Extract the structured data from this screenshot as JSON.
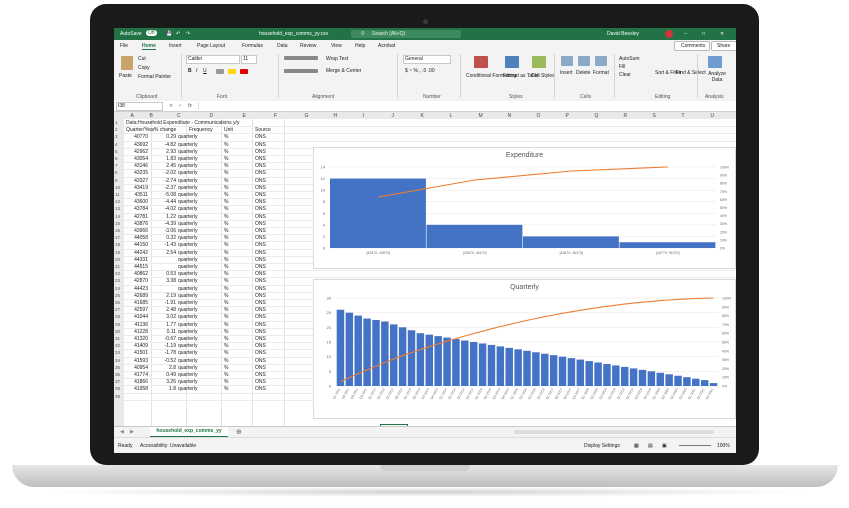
{
  "window": {
    "autosave_label": "AutoSave",
    "autosave_state": "Off",
    "file_name": "household_exp_comms_yy.csv",
    "search_placeholder": "Search (Alt+Q)",
    "user_name": "David Beesley"
  },
  "menu": {
    "tabs": [
      "File",
      "Home",
      "Insert",
      "Page Layout",
      "Formulas",
      "Data",
      "Review",
      "View",
      "Help",
      "Acrobat"
    ],
    "active_tab": "Home",
    "comments_label": "Comments",
    "share_label": "Share"
  },
  "ribbon": {
    "clipboard": {
      "paste": "Paste",
      "cut": "Cut",
      "copy": "Copy",
      "format_painter": "Format Painter",
      "label": "Clipboard"
    },
    "font": {
      "name": "Calibri",
      "size": "11",
      "label": "Font"
    },
    "alignment": {
      "wrap_text": "Wrap Text",
      "merge_center": "Merge & Center",
      "label": "Alignment"
    },
    "number": {
      "format": "General",
      "label": "Number"
    },
    "styles": {
      "conditional": "Conditional Formatting",
      "format_table": "Format as Table",
      "cell_styles": "Cell Styles",
      "label": "Styles"
    },
    "cells": {
      "insert": "Insert",
      "delete": "Delete",
      "format": "Format",
      "label": "Cells"
    },
    "editing": {
      "autosum": "AutoSum",
      "fill": "Fill",
      "clear": "Clear",
      "sort_filter": "Sort & Filter",
      "find_select": "Find & Select",
      "label": "Editing"
    },
    "analysis": {
      "analyze": "Analyze Data",
      "label": "Analysis"
    }
  },
  "formula_bar": {
    "name_box": "I38",
    "fx": "fx"
  },
  "columns": [
    "A",
    "B",
    "C",
    "D",
    "E",
    "F",
    "G",
    "H",
    "I",
    "J",
    "K",
    "L",
    "M",
    "N",
    "O",
    "P",
    "Q",
    "R",
    "S",
    "T",
    "U"
  ],
  "sheet": {
    "title_row": "Data:Household Expenditure - Communications y/y",
    "headers": [
      "Quarter/Year",
      "% change",
      "Frequency",
      "Unit",
      "Source"
    ],
    "rows": [
      [
        "40770",
        "0.29",
        "quarterly",
        "%",
        "ONS"
      ],
      [
        "43692",
        "-4.82",
        "quarterly",
        "%",
        "ONS"
      ],
      [
        "42962",
        "2.93",
        "quarterly",
        "%",
        "ONS"
      ],
      [
        "43054",
        "1.83",
        "quarterly",
        "%",
        "ONS"
      ],
      [
        "43146",
        "2.45",
        "quarterly",
        "%",
        "ONS"
      ],
      [
        "43235",
        "-2.02",
        "quarterly",
        "%",
        "ONS"
      ],
      [
        "43327",
        "-2.74",
        "quarterly",
        "%",
        "ONS"
      ],
      [
        "43419",
        "-2.37",
        "quarterly",
        "%",
        "ONS"
      ],
      [
        "43511",
        "-5.08",
        "quarterly",
        "%",
        "ONS"
      ],
      [
        "43600",
        "-4.44",
        "quarterly",
        "%",
        "ONS"
      ],
      [
        "43784",
        "-4.02",
        "quarterly",
        "%",
        "ONS"
      ],
      [
        "42781",
        "1.22",
        "quarterly",
        "%",
        "ONS"
      ],
      [
        "43876",
        "-4.39",
        "quarterly",
        "%",
        "ONS"
      ],
      [
        "43966",
        "-3.06",
        "quarterly",
        "%",
        "ONS"
      ],
      [
        "44058",
        "0.32",
        "quarterly",
        "%",
        "ONS"
      ],
      [
        "44150",
        "-1.43",
        "quarterly",
        "%",
        "ONS"
      ],
      [
        "44242",
        "2.54",
        "quarterly",
        "%",
        "ONS"
      ],
      [
        "44331",
        "",
        "quarterly",
        "%",
        "ONS"
      ],
      [
        "44515",
        "",
        "quarterly",
        "%",
        "ONS"
      ],
      [
        "40862",
        "0.53",
        "quarterly",
        "%",
        "ONS"
      ],
      [
        "42870",
        "3.38",
        "quarterly",
        "%",
        "ONS"
      ],
      [
        "44423",
        "",
        "quarterly",
        "%",
        "ONS"
      ],
      [
        "42689",
        "2.19",
        "quarterly",
        "%",
        "ONS"
      ],
      [
        "41685",
        "-1.91",
        "quarterly",
        "%",
        "ONS"
      ],
      [
        "42597",
        "2.48",
        "quarterly",
        "%",
        "ONS"
      ],
      [
        "41044",
        "3.02",
        "quarterly",
        "%",
        "ONS"
      ],
      [
        "41136",
        "1.77",
        "quarterly",
        "%",
        "ONS"
      ],
      [
        "41228",
        "0.11",
        "quarterly",
        "%",
        "ONS"
      ],
      [
        "41320",
        "-0.67",
        "quarterly",
        "%",
        "ONS"
      ],
      [
        "41409",
        "-1.19",
        "quarterly",
        "%",
        "ONS"
      ],
      [
        "41501",
        "-1.78",
        "quarterly",
        "%",
        "ONS"
      ],
      [
        "41593",
        "-0.52",
        "quarterly",
        "%",
        "ONS"
      ],
      [
        "40954",
        "2.8",
        "quarterly",
        "%",
        "ONS"
      ],
      [
        "41774",
        "0.49",
        "quarterly",
        "%",
        "ONS"
      ],
      [
        "41866",
        "3.26",
        "quarterly",
        "%",
        "ONS"
      ],
      [
        "41958",
        "1.8",
        "quarterly",
        "%",
        "ONS"
      ]
    ]
  },
  "sheet_tab": "household_exp_comms_yy",
  "status": {
    "ready": "Ready",
    "accessibility": "Accessibility: Unavailable",
    "display_settings": "Display Settings",
    "zoom": "100%"
  },
  "colors": {
    "excel_green": "#217346",
    "bar_blue": "#4472c4",
    "line_orange": "#ed7d31"
  },
  "chart_data": [
    {
      "type": "bar",
      "title": "Expenditure",
      "categories": [
        "[42470, 43670]",
        "[43670, 45170]",
        "[43670, 46370]",
        "[44770, 51070]"
      ],
      "values": [
        12,
        4,
        2,
        1
      ],
      "ylim": [
        0,
        14
      ],
      "yticks": [
        "0",
        "2",
        "4",
        "6",
        "8",
        "10",
        "12",
        "14"
      ],
      "y2ticks": [
        "0%",
        "10%",
        "20%",
        "30%",
        "40%",
        "50%",
        "60%",
        "70%",
        "80%",
        "90%",
        "100%"
      ],
      "cumulative_pct": [
        63,
        84,
        95,
        100
      ]
    },
    {
      "type": "bar",
      "title": "Quarterly",
      "categories": [
        "Q1 2011",
        "Q2 2011",
        "Q3 2011",
        "Q4 2011",
        "Q1 2012",
        "Q2 2012",
        "Q3 2012",
        "Q4 2012",
        "Q1 2013",
        "Q2 2013",
        "Q3 2013",
        "Q4 2013",
        "Q1 2014",
        "Q2 2014",
        "Q3 2014",
        "Q4 2014",
        "Q1 2015",
        "Q2 2015",
        "Q3 2015",
        "Q4 2015",
        "Q1 2016",
        "Q2 2016",
        "Q3 2016",
        "Q4 2016",
        "Q1 2017",
        "Q2 2017",
        "Q3 2017",
        "Q4 2017",
        "Q1 2018",
        "Q2 2018",
        "Q3 2018",
        "Q4 2018",
        "Q1 2019",
        "Q2 2019",
        "Q3 2019",
        "Q4 2019",
        "Q1 2020",
        "Q2 2020",
        "Q3 2020",
        "Q4 2020",
        "Q1 2021",
        "Q2 2021",
        "Q3 2021"
      ],
      "values": [
        26,
        25,
        24,
        23,
        22.5,
        22,
        21,
        20,
        19,
        18,
        17.5,
        17,
        16.5,
        16,
        15.5,
        15,
        14.5,
        14,
        13.5,
        13,
        12.5,
        12,
        11.5,
        11,
        10.5,
        10,
        9.5,
        9,
        8.5,
        8,
        7.5,
        7,
        6.5,
        6,
        5.5,
        5,
        4.5,
        4,
        3.5,
        3,
        2.5,
        2,
        1
      ],
      "ylim": [
        0,
        30
      ],
      "yticks": [
        "0",
        "5",
        "10",
        "15",
        "20",
        "25",
        "30"
      ],
      "y2ticks": [
        "0%",
        "10%",
        "20%",
        "30%",
        "40%",
        "50%",
        "60%",
        "70%",
        "80%",
        "90%",
        "100%"
      ]
    }
  ]
}
